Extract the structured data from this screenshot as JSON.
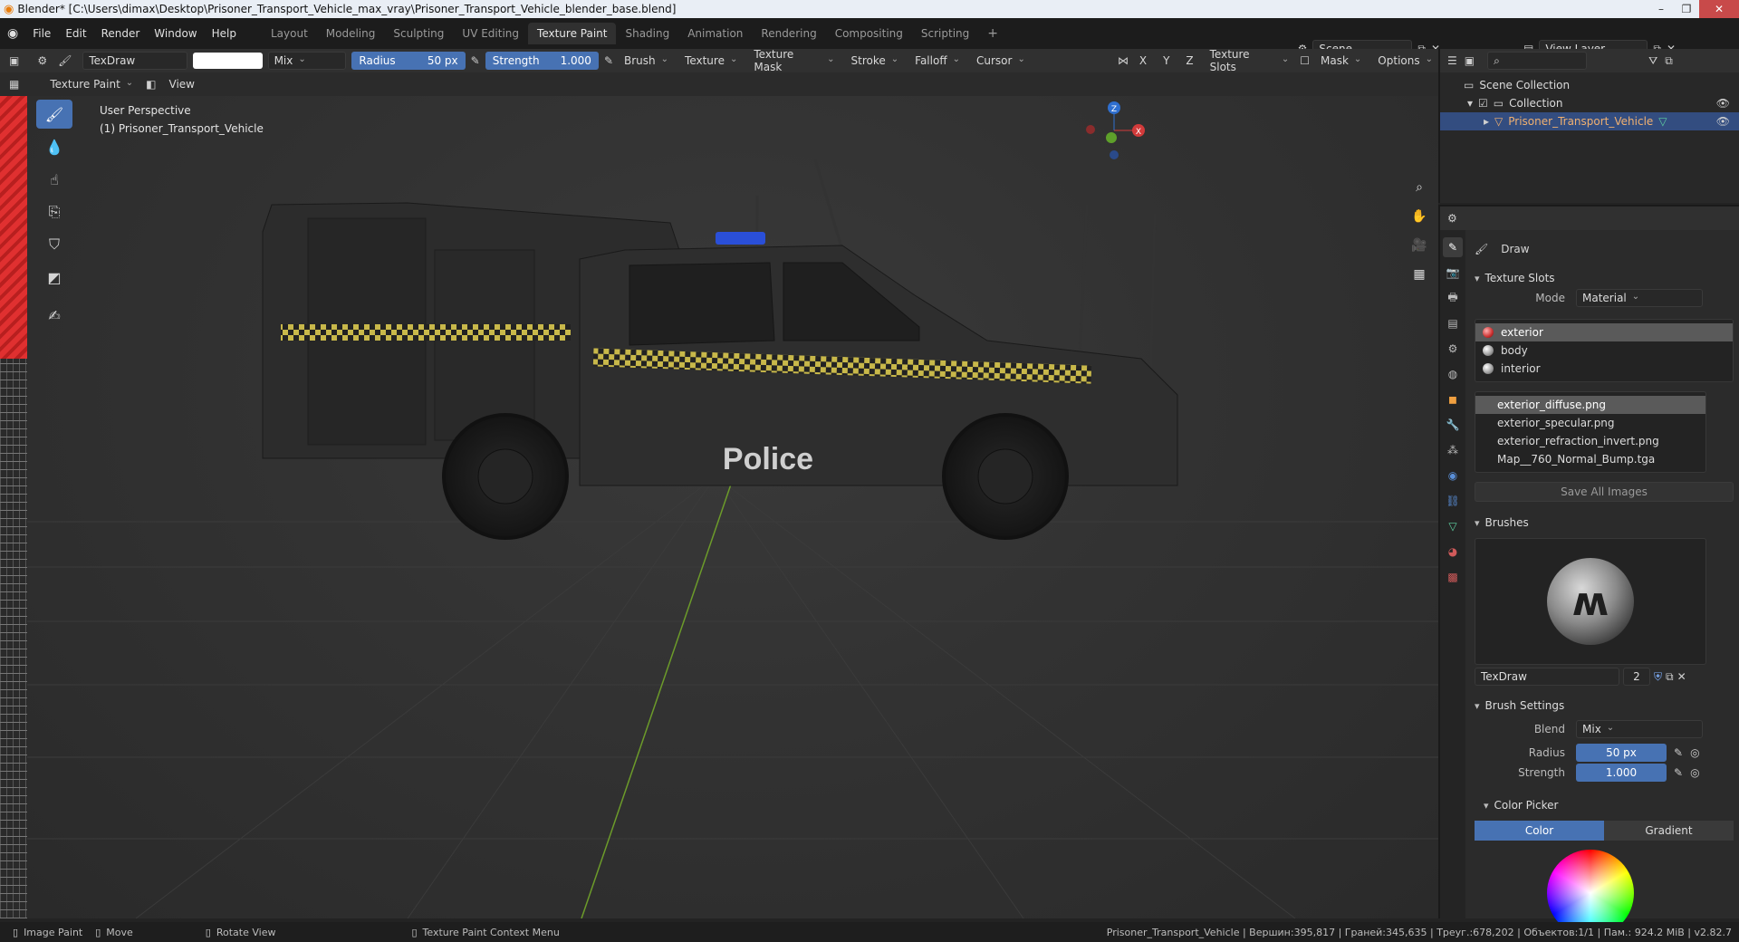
{
  "window": {
    "title": "Blender* [C:\\Users\\dimax\\Desktop\\Prisoner_Transport_Vehicle_max_vray\\Prisoner_Transport_Vehicle_blender_base.blend]"
  },
  "menu": [
    "File",
    "Edit",
    "Render",
    "Window",
    "Help"
  ],
  "workspaces": [
    {
      "label": "Layout",
      "active": false
    },
    {
      "label": "Modeling",
      "active": false
    },
    {
      "label": "Sculpting",
      "active": false
    },
    {
      "label": "UV Editing",
      "active": false
    },
    {
      "label": "Texture Paint",
      "active": true
    },
    {
      "label": "Shading",
      "active": false
    },
    {
      "label": "Animation",
      "active": false
    },
    {
      "label": "Rendering",
      "active": false
    },
    {
      "label": "Compositing",
      "active": false
    },
    {
      "label": "Scripting",
      "active": false
    }
  ],
  "add_workspace": "+",
  "scene": {
    "name": "Scene",
    "view_layer": "View Layer"
  },
  "tool_header": {
    "brush_name": "TexDraw",
    "blend_mode": "Mix",
    "radius_label": "Radius",
    "radius_value": "50 px",
    "strength_label": "Strength",
    "strength_value": "1.000",
    "menus": [
      "Brush",
      "Texture",
      "Texture Mask",
      "Stroke",
      "Falloff",
      "Cursor"
    ],
    "axis_x": "X",
    "axis_y": "Y",
    "axis_z": "Z",
    "texture_slots_label": "Texture Slots",
    "mask_label": "Mask",
    "options_label": "Options"
  },
  "mode_bar": {
    "mode": "Texture Paint",
    "view_menu": "View"
  },
  "viewport": {
    "perspective": "User Perspective",
    "object_label": "(1) Prisoner_Transport_Vehicle",
    "vehicle_text": "Police",
    "gizmo": {
      "x": "X",
      "y": "Y",
      "z": "Z"
    }
  },
  "outliner": {
    "scene_collection": "Scene Collection",
    "collection": "Collection",
    "object": "Prisoner_Transport_Vehicle"
  },
  "properties": {
    "tool_name": "Draw",
    "texture_slots_title": "Texture Slots",
    "mode_label": "Mode",
    "mode_value": "Material",
    "materials": [
      {
        "label": "exterior",
        "selected": true
      },
      {
        "label": "body",
        "selected": false
      },
      {
        "label": "interior",
        "selected": false
      }
    ],
    "images": [
      {
        "label": "exterior_diffuse.png",
        "selected": true
      },
      {
        "label": "exterior_specular.png",
        "selected": false
      },
      {
        "label": "exterior_refraction_invert.png",
        "selected": false
      },
      {
        "label": "Map__760_Normal_Bump.tga",
        "selected": false
      }
    ],
    "save_all_images": "Save All Images",
    "brushes_title": "Brushes",
    "brush_name": "TexDraw",
    "brush_users": "2",
    "brush_settings_title": "Brush Settings",
    "blend_label": "Blend",
    "blend_value": "Mix",
    "radius_label": "Radius",
    "radius_value": "50 px",
    "strength_label": "Strength",
    "strength_value": "1.000",
    "color_picker_title": "Color Picker",
    "color_tab": "Color",
    "gradient_tab": "Gradient"
  },
  "status_bar": {
    "left": [
      {
        "icon": "mouse-left-icon",
        "label": "Image Paint"
      },
      {
        "icon": "mouse-middle-icon",
        "label": "Move"
      },
      {
        "icon": "mouse-right-icon",
        "label": "Rotate View"
      },
      {
        "icon": "mouse-menu-icon",
        "label": "Texture Paint Context Menu"
      }
    ],
    "stats": "Prisoner_Transport_Vehicle | Вершин:395,817 | Граней:345,635 | Треуг.:678,202 | Объектов:1/1 | Пам.: 924.2 MiB | v2.82.7"
  },
  "colors": {
    "accent": "#4772b3",
    "header_bg": "#303030",
    "selected_object_text": "#f0b070",
    "stripe_yellow": "#c8b84a"
  }
}
